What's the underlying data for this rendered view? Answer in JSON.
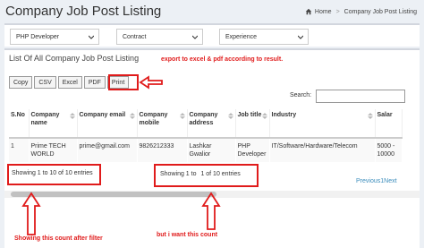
{
  "header": {
    "title": "Company Job Post Listing",
    "breadcrumb_home": "Home",
    "breadcrumb_current": "Company Job Post Listing"
  },
  "filters": {
    "role": "PHP Developer",
    "type": "Contract",
    "experience": "Experience"
  },
  "panel": {
    "title": "List Of All Company Job Post Listing",
    "export_note": "export to excel & pdf  according to result.",
    "buttons": [
      "Copy",
      "CSV",
      "Excel",
      "PDF",
      "Print"
    ],
    "search_label": "Search:"
  },
  "table": {
    "headers": [
      "S.No",
      "Company name",
      "Company email",
      "Company mobile",
      "Company address",
      "Job title",
      "Industry",
      "Salar"
    ],
    "rows": [
      [
        "1",
        "Prime TECH WORLD",
        "prime@gmail.com",
        "9826212333",
        "Lashkar Gwalior",
        "PHP Developer",
        "IT/Software/Hardware/Telecom",
        "5000 - 10000"
      ]
    ]
  },
  "info": {
    "left": "Showing 1 to 10 of 10 entries",
    "right_prefix": "Showing 1 to",
    "right_suffix": "1 of 10 entries"
  },
  "pager": {
    "prev": "Previous",
    "page": "1",
    "next": "Next"
  },
  "annotations": {
    "left": "Showing this count after filter",
    "right": "but i want this count"
  },
  "colors": {
    "annotation": "#e01b1b",
    "link": "#3c8dbc"
  }
}
